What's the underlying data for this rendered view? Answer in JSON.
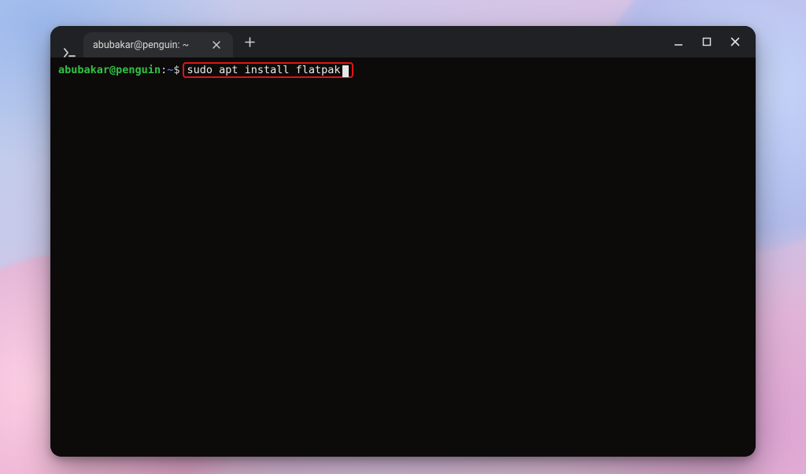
{
  "tab": {
    "title": "abubakar@penguin: ~"
  },
  "prompt": {
    "user": "abubakar",
    "host": "penguin",
    "path": "~",
    "symbol": "$"
  },
  "command": "sudo apt install flatpak",
  "icons": {
    "app": "terminal-icon",
    "close_tab": "close-icon",
    "new_tab": "plus-icon",
    "minimize": "minimize-icon",
    "maximize": "maximize-icon",
    "close_window": "close-icon"
  }
}
